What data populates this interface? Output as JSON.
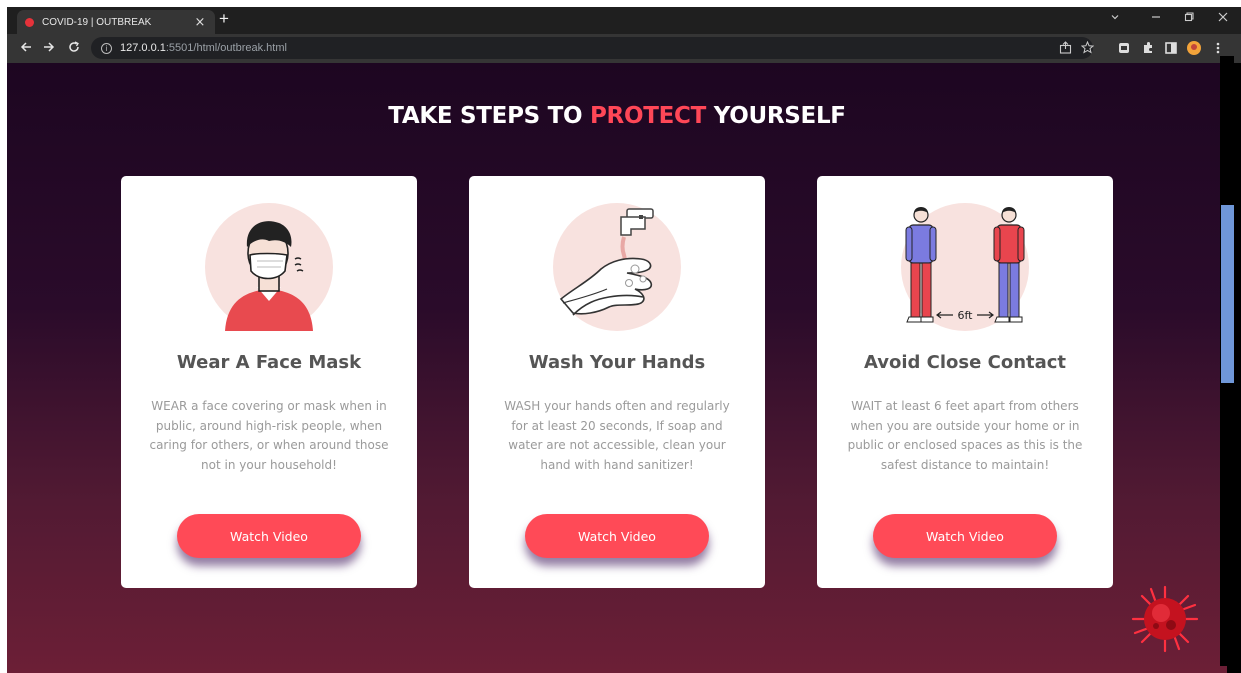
{
  "browser": {
    "tab_title": "COVID-19 | OUTBREAK",
    "tab_close": "×",
    "new_tab": "+",
    "url_host": "127.0.0.1",
    "url_path": ":5501/html/outbreak.html"
  },
  "page": {
    "headline_pre": "TAKE STEPS TO ",
    "headline_accent": "PROTECT",
    "headline_post": " YOURSELF",
    "cards": [
      {
        "title": "Wear A Face Mask",
        "text": "WEAR a face covering or mask when in public, around high-risk people, when caring for others, or when around those not in your household!",
        "button": "Watch Video"
      },
      {
        "title": "Wash Your Hands",
        "text": "WASH your hands often and regularly for at least 20 seconds, If soap and water are not accessible, clean your hand with hand sanitizer!",
        "button": "Watch Video"
      },
      {
        "title": "Avoid Close Contact",
        "text": "WAIT at least 6 feet apart from others when you are outside your home or in public or enclosed spaces as this is the safest distance to maintain!",
        "button": "Watch Video",
        "illustration_label": "6ft"
      }
    ]
  },
  "colors": {
    "accent": "#ff4757",
    "button": "#ff4a57",
    "background_top": "#1d0621",
    "background_bottom": "#6c1f36",
    "scroll_thumb": "#6f97d8"
  }
}
